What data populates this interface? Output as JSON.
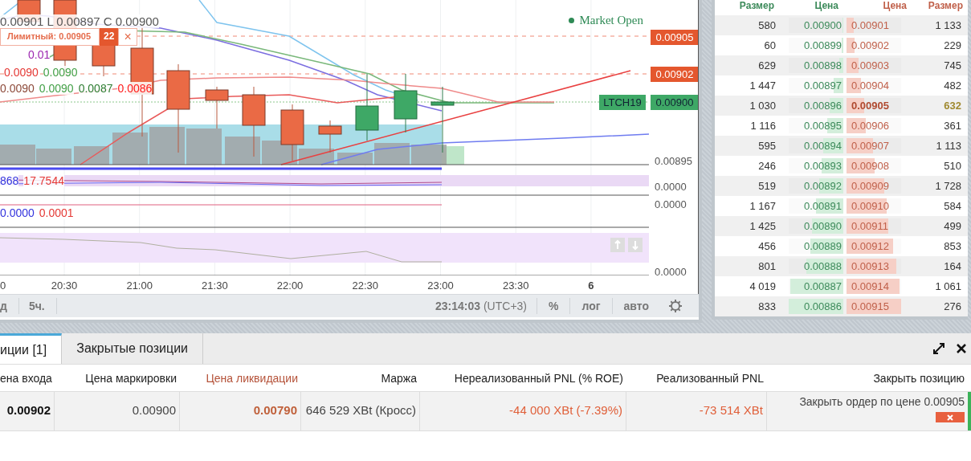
{
  "chart": {
    "ohlc_legend": "0.00901 L 0.00897 C 0.00900",
    "order_line": {
      "label": "Лимитный: 0.00905",
      "quantity": "22",
      "close": "×"
    },
    "legend_rows": [
      {
        "items": [
          {
            "text": "0.01",
            "color": "#9c27b0"
          }
        ]
      },
      {
        "items": [
          {
            "text": "0.0090",
            "color": "#e53935"
          },
          {
            "text": "0.0090",
            "color": "#43a047"
          }
        ]
      },
      {
        "items": [
          {
            "text": "0.0090",
            "color": "#8d4a3a"
          },
          {
            "text": "0.0090",
            "color": "#43a047"
          },
          {
            "text": "0.0087",
            "color": "#2e7d32"
          },
          {
            "text": "0.0086",
            "color": "#ff1a1a"
          }
        ]
      }
    ],
    "market_status": "Market Open",
    "price_tags": [
      {
        "text": "0.00905",
        "kind": "order"
      },
      {
        "text": "0.00902",
        "kind": "order"
      },
      {
        "text": "0.00900",
        "kind": "last",
        "symbol": "LTCH19"
      }
    ],
    "price_axis_label": "0.00895",
    "indicator_panes": [
      {
        "values": [
          {
            "text": "868",
            "color": "#3333dd"
          },
          {
            "text": "17.7544",
            "color": "#e53935"
          }
        ],
        "axis_label": "0.0000"
      },
      {
        "values": [
          {
            "text": "0.0000",
            "color": "#3333dd"
          },
          {
            "text": "0.0001",
            "color": "#e53935"
          }
        ],
        "axis_label": "0.0000"
      },
      {
        "axis_label": "0.0000"
      }
    ],
    "time_labels": [
      {
        "text": "0",
        "bold": false
      },
      {
        "text": "20:30",
        "bold": false
      },
      {
        "text": "21:00",
        "bold": false
      },
      {
        "text": "21:30",
        "bold": false
      },
      {
        "text": "22:00",
        "bold": false
      },
      {
        "text": "22:30",
        "bold": false
      },
      {
        "text": "23:00",
        "bold": false
      },
      {
        "text": "23:30",
        "bold": false
      },
      {
        "text": "6",
        "bold": true
      }
    ],
    "toolbar": {
      "intervals": [
        "д",
        "5ч."
      ],
      "time": "23:14:03",
      "timezone": "(UTC+3)",
      "options": [
        "%",
        "лог",
        "авто"
      ]
    }
  },
  "order_book": {
    "columns": [
      "Размер",
      "Цена",
      "Цена",
      "Размер"
    ],
    "rows": [
      {
        "bid": {
          "size": "580",
          "price": "0.00900",
          "level": 0.02
        },
        "ask": {
          "price": "0.00901",
          "size": "1 133",
          "level": 0.13
        },
        "highlighted": false
      },
      {
        "bid": {
          "size": "60",
          "price": "0.00899",
          "level": 0.03
        },
        "ask": {
          "price": "0.00902",
          "size": "229",
          "level": 0.15
        },
        "highlighted": false
      },
      {
        "bid": {
          "size": "629",
          "price": "0.00898",
          "level": 0.08
        },
        "ask": {
          "price": "0.00903",
          "size": "745",
          "level": 0.22
        },
        "highlighted": false
      },
      {
        "bid": {
          "size": "1 447",
          "price": "0.00897",
          "level": 0.17
        },
        "ask": {
          "price": "0.00904",
          "size": "482",
          "level": 0.26
        },
        "highlighted": false
      },
      {
        "bid": {
          "size": "1 030",
          "price": "0.00896",
          "level": 0.25
        },
        "ask": {
          "price": "0.00905",
          "size": "632",
          "level": 0.33
        },
        "highlighted": true
      },
      {
        "bid": {
          "size": "1 116",
          "price": "0.00895",
          "level": 0.3
        },
        "ask": {
          "price": "0.00906",
          "size": "361",
          "level": 0.36
        },
        "highlighted": false
      },
      {
        "bid": {
          "size": "595",
          "price": "0.00894",
          "level": 0.37
        },
        "ask": {
          "price": "0.00907",
          "size": "1 113",
          "level": 0.48
        },
        "highlighted": false
      },
      {
        "bid": {
          "size": "246",
          "price": "0.00893",
          "level": 0.39
        },
        "ask": {
          "price": "0.00908",
          "size": "510",
          "level": 0.52
        },
        "highlighted": false
      },
      {
        "bid": {
          "size": "519",
          "price": "0.00892",
          "level": 0.44
        },
        "ask": {
          "price": "0.00909",
          "size": "1 728",
          "level": 0.69
        },
        "highlighted": false
      },
      {
        "bid": {
          "size": "1 167",
          "price": "0.00891",
          "level": 0.5
        },
        "ask": {
          "price": "0.00910",
          "size": "584",
          "level": 0.74
        },
        "highlighted": false
      },
      {
        "bid": {
          "size": "1 425",
          "price": "0.00890",
          "level": 0.57
        },
        "ask": {
          "price": "0.00911",
          "size": "499",
          "level": 0.77
        },
        "highlighted": false
      },
      {
        "bid": {
          "size": "456",
          "price": "0.00889",
          "level": 0.6
        },
        "ask": {
          "price": "0.00912",
          "size": "853",
          "level": 0.85
        },
        "highlighted": false
      },
      {
        "bid": {
          "size": "801",
          "price": "0.00888",
          "level": 0.67
        },
        "ask": {
          "price": "0.00913",
          "size": "164",
          "level": 0.91
        },
        "highlighted": false
      },
      {
        "bid": {
          "size": "4 019",
          "price": "0.00887",
          "level": 0.97
        },
        "ask": {
          "price": "0.00914",
          "size": "1 061",
          "level": 0.97
        },
        "highlighted": false
      },
      {
        "bid": {
          "size": "833",
          "price": "0.00886",
          "level": 1.0
        },
        "ask": {
          "price": "0.00915",
          "size": "276",
          "level": 1.0
        },
        "highlighted": false
      }
    ]
  },
  "positions": {
    "tabs": [
      {
        "label": "иции [1]",
        "selected": true
      },
      {
        "label": "Закрытые позиции",
        "selected": false
      }
    ],
    "columns": [
      {
        "label": "ена входа",
        "highlight": false
      },
      {
        "label": "Цена маркировки",
        "highlight": false
      },
      {
        "label": "Цена ликвидации",
        "highlight": true
      },
      {
        "label": "Маржа",
        "highlight": false
      },
      {
        "label": "Нереализованный PNL (% ROE)",
        "highlight": false
      },
      {
        "label": "Реализованный PNL",
        "highlight": false
      },
      {
        "label": "Закрыть позицию",
        "highlight": false
      }
    ],
    "row": {
      "cells": [
        {
          "text": "0.00902",
          "kind": "strong"
        },
        {
          "text": "0.00900",
          "kind": "plain"
        },
        {
          "text": "0.00790",
          "kind": "liquidation"
        },
        {
          "text": "646 529 XBt (Кросс)",
          "kind": "plain"
        },
        {
          "text": "-44 000 XBt (-7.39%)",
          "kind": "loss"
        },
        {
          "text": "-73 514 XBt",
          "kind": "loss"
        }
      ],
      "close_order": "Закрыть ордер по цене 0.00905"
    }
  }
}
